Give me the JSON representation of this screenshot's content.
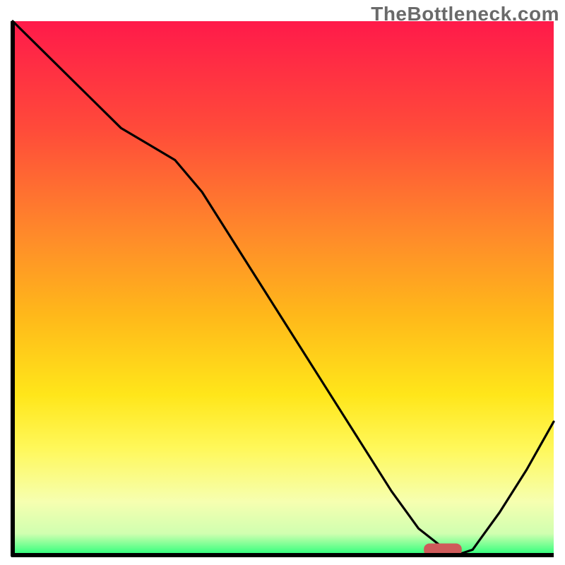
{
  "watermark": "TheBottleneck.com",
  "chart_data": {
    "type": "line",
    "title": "",
    "xlabel": "",
    "ylabel": "",
    "xlim": [
      0,
      100
    ],
    "ylim": [
      0,
      100
    ],
    "grid": false,
    "legend": false,
    "x": [
      0,
      5,
      10,
      15,
      20,
      25,
      30,
      35,
      40,
      45,
      50,
      55,
      60,
      65,
      70,
      75,
      80,
      82,
      85,
      90,
      95,
      100
    ],
    "values": [
      100,
      95,
      90,
      85,
      80,
      77,
      74,
      68,
      60,
      52,
      44,
      36,
      28,
      20,
      12,
      5,
      1,
      0,
      1,
      8,
      16,
      25
    ],
    "marker": {
      "start_x": 76,
      "end_x": 83,
      "y": 1
    },
    "gradient_stops": [
      {
        "pct": 0,
        "color": "#ff1a4a"
      },
      {
        "pct": 20,
        "color": "#ff4a3a"
      },
      {
        "pct": 40,
        "color": "#ff8a2a"
      },
      {
        "pct": 55,
        "color": "#ffb81a"
      },
      {
        "pct": 70,
        "color": "#ffe61a"
      },
      {
        "pct": 80,
        "color": "#fff85a"
      },
      {
        "pct": 90,
        "color": "#f6ffb0"
      },
      {
        "pct": 96,
        "color": "#d0ffb0"
      },
      {
        "pct": 100,
        "color": "#2aff7a"
      }
    ],
    "marker_color": "#cf5a5a",
    "line_color": "#000000",
    "axis_color": "#000000"
  }
}
